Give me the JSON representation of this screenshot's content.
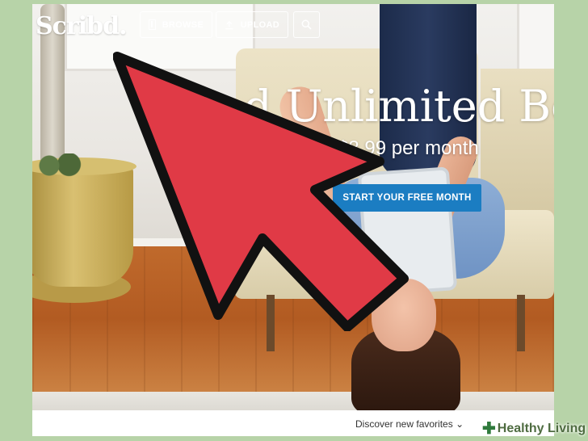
{
  "header": {
    "logo": "Scribd.",
    "browse_label": "BROWSE",
    "upload_label": "UPLOAD"
  },
  "hero": {
    "title": "d Unlimited Bo",
    "price": "$8.99 per month",
    "cta_label": "START YOUR FREE MONTH"
  },
  "footer": {
    "discover_label": "Discover new favorites"
  },
  "watermark": {
    "text": "Healthy Living"
  },
  "colors": {
    "accent": "#1b7dc2",
    "arrow": "#e03a46",
    "border": "#b7d3a8"
  }
}
